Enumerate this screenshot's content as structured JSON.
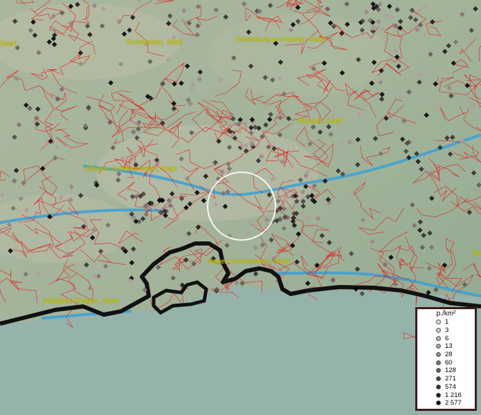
{
  "map": {
    "city_labels": [
      {
        "id": "dornstetten",
        "text": "Dornstetten, Stadt"
      },
      {
        "id": "rottenburg",
        "text": "Rottenburg am Neckar, Stadt"
      },
      {
        "id": "albstadt",
        "text": "Albstadt, Stadt"
      },
      {
        "id": "villingen",
        "text": "Villingen-Schwenningen, Stadt"
      },
      {
        "id": "singen",
        "text": "Singen (Hohentwiel), Stadt"
      },
      {
        "id": "waldshut",
        "text": "Waldshut-Tiengen, Stadt"
      },
      {
        "id": "left-edge",
        "text": "Stadt"
      },
      {
        "id": "right-edge",
        "text": "Ra"
      }
    ],
    "colors": {
      "boundary": "#e02020",
      "river": "#3aa0d8",
      "border": "#111111",
      "label": "#d8d800",
      "terrain": "#9fb19a",
      "lowland": "#96b3a8"
    }
  },
  "legend": {
    "title": "p./km²",
    "entries": [
      {
        "label": "1",
        "color": "#eddcdc"
      },
      {
        "label": "3",
        "color": "#ddc6c6"
      },
      {
        "label": "6",
        "color": "#cdb2b2"
      },
      {
        "label": "13",
        "color": "#b39c9c"
      },
      {
        "label": "28",
        "color": "#9a8686"
      },
      {
        "label": "60",
        "color": "#807070"
      },
      {
        "label": "128",
        "color": "#675a5a"
      },
      {
        "label": "271",
        "color": "#4e4444"
      },
      {
        "label": "574",
        "color": "#352e2e"
      },
      {
        "label": "1 216",
        "color": "#1c1818"
      },
      {
        "label": "2 577",
        "color": "#050404"
      }
    ]
  }
}
